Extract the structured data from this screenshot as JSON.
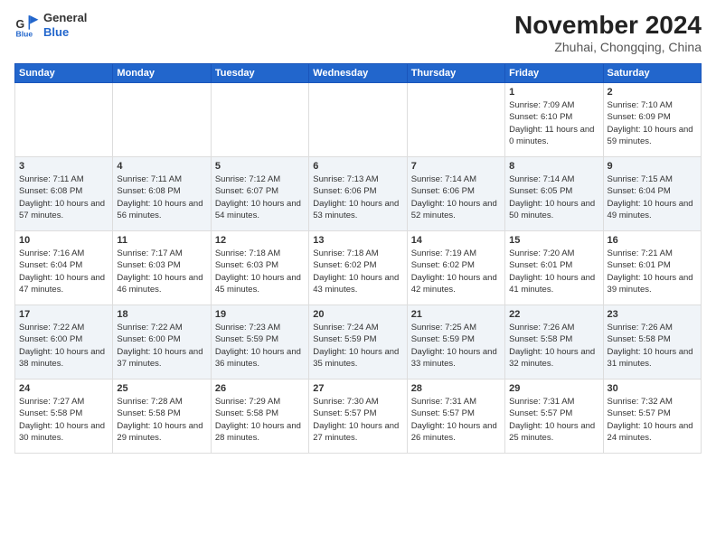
{
  "header": {
    "logo": {
      "general": "General",
      "blue": "Blue"
    },
    "title": "November 2024",
    "subtitle": "Zhuhai, Chongqing, China"
  },
  "columns": [
    "Sunday",
    "Monday",
    "Tuesday",
    "Wednesday",
    "Thursday",
    "Friday",
    "Saturday"
  ],
  "weeks": [
    [
      {
        "day": "",
        "content": ""
      },
      {
        "day": "",
        "content": ""
      },
      {
        "day": "",
        "content": ""
      },
      {
        "day": "",
        "content": ""
      },
      {
        "day": "",
        "content": ""
      },
      {
        "day": "1",
        "content": "Sunrise: 7:09 AM\nSunset: 6:10 PM\nDaylight: 11 hours and 0 minutes."
      },
      {
        "day": "2",
        "content": "Sunrise: 7:10 AM\nSunset: 6:09 PM\nDaylight: 10 hours and 59 minutes."
      }
    ],
    [
      {
        "day": "3",
        "content": "Sunrise: 7:11 AM\nSunset: 6:08 PM\nDaylight: 10 hours and 57 minutes."
      },
      {
        "day": "4",
        "content": "Sunrise: 7:11 AM\nSunset: 6:08 PM\nDaylight: 10 hours and 56 minutes."
      },
      {
        "day": "5",
        "content": "Sunrise: 7:12 AM\nSunset: 6:07 PM\nDaylight: 10 hours and 54 minutes."
      },
      {
        "day": "6",
        "content": "Sunrise: 7:13 AM\nSunset: 6:06 PM\nDaylight: 10 hours and 53 minutes."
      },
      {
        "day": "7",
        "content": "Sunrise: 7:14 AM\nSunset: 6:06 PM\nDaylight: 10 hours and 52 minutes."
      },
      {
        "day": "8",
        "content": "Sunrise: 7:14 AM\nSunset: 6:05 PM\nDaylight: 10 hours and 50 minutes."
      },
      {
        "day": "9",
        "content": "Sunrise: 7:15 AM\nSunset: 6:04 PM\nDaylight: 10 hours and 49 minutes."
      }
    ],
    [
      {
        "day": "10",
        "content": "Sunrise: 7:16 AM\nSunset: 6:04 PM\nDaylight: 10 hours and 47 minutes."
      },
      {
        "day": "11",
        "content": "Sunrise: 7:17 AM\nSunset: 6:03 PM\nDaylight: 10 hours and 46 minutes."
      },
      {
        "day": "12",
        "content": "Sunrise: 7:18 AM\nSunset: 6:03 PM\nDaylight: 10 hours and 45 minutes."
      },
      {
        "day": "13",
        "content": "Sunrise: 7:18 AM\nSunset: 6:02 PM\nDaylight: 10 hours and 43 minutes."
      },
      {
        "day": "14",
        "content": "Sunrise: 7:19 AM\nSunset: 6:02 PM\nDaylight: 10 hours and 42 minutes."
      },
      {
        "day": "15",
        "content": "Sunrise: 7:20 AM\nSunset: 6:01 PM\nDaylight: 10 hours and 41 minutes."
      },
      {
        "day": "16",
        "content": "Sunrise: 7:21 AM\nSunset: 6:01 PM\nDaylight: 10 hours and 39 minutes."
      }
    ],
    [
      {
        "day": "17",
        "content": "Sunrise: 7:22 AM\nSunset: 6:00 PM\nDaylight: 10 hours and 38 minutes."
      },
      {
        "day": "18",
        "content": "Sunrise: 7:22 AM\nSunset: 6:00 PM\nDaylight: 10 hours and 37 minutes."
      },
      {
        "day": "19",
        "content": "Sunrise: 7:23 AM\nSunset: 5:59 PM\nDaylight: 10 hours and 36 minutes."
      },
      {
        "day": "20",
        "content": "Sunrise: 7:24 AM\nSunset: 5:59 PM\nDaylight: 10 hours and 35 minutes."
      },
      {
        "day": "21",
        "content": "Sunrise: 7:25 AM\nSunset: 5:59 PM\nDaylight: 10 hours and 33 minutes."
      },
      {
        "day": "22",
        "content": "Sunrise: 7:26 AM\nSunset: 5:58 PM\nDaylight: 10 hours and 32 minutes."
      },
      {
        "day": "23",
        "content": "Sunrise: 7:26 AM\nSunset: 5:58 PM\nDaylight: 10 hours and 31 minutes."
      }
    ],
    [
      {
        "day": "24",
        "content": "Sunrise: 7:27 AM\nSunset: 5:58 PM\nDaylight: 10 hours and 30 minutes."
      },
      {
        "day": "25",
        "content": "Sunrise: 7:28 AM\nSunset: 5:58 PM\nDaylight: 10 hours and 29 minutes."
      },
      {
        "day": "26",
        "content": "Sunrise: 7:29 AM\nSunset: 5:58 PM\nDaylight: 10 hours and 28 minutes."
      },
      {
        "day": "27",
        "content": "Sunrise: 7:30 AM\nSunset: 5:57 PM\nDaylight: 10 hours and 27 minutes."
      },
      {
        "day": "28",
        "content": "Sunrise: 7:31 AM\nSunset: 5:57 PM\nDaylight: 10 hours and 26 minutes."
      },
      {
        "day": "29",
        "content": "Sunrise: 7:31 AM\nSunset: 5:57 PM\nDaylight: 10 hours and 25 minutes."
      },
      {
        "day": "30",
        "content": "Sunrise: 7:32 AM\nSunset: 5:57 PM\nDaylight: 10 hours and 24 minutes."
      }
    ]
  ]
}
